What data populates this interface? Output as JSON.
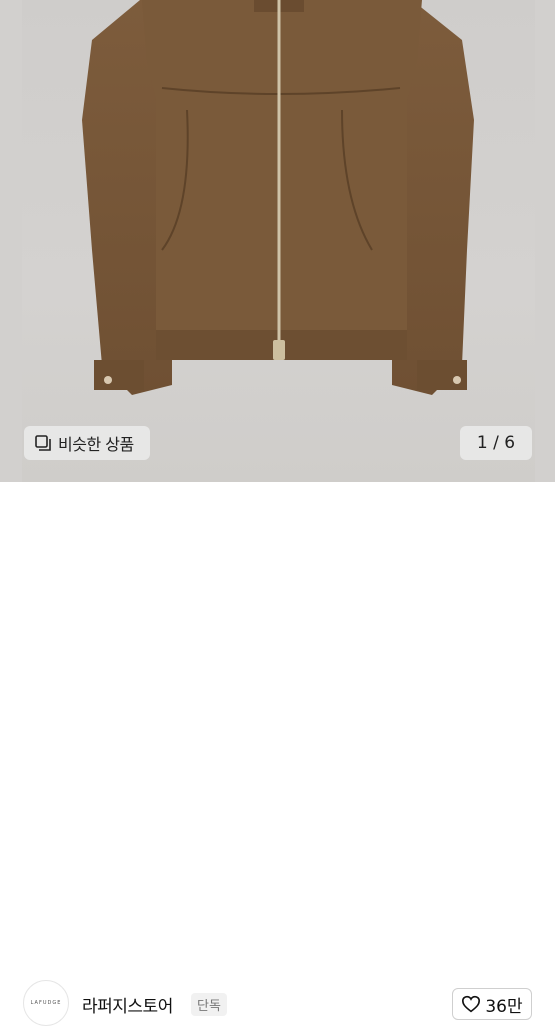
{
  "similar_button": {
    "label": "비슷한 상품",
    "icon": "similar-items-icon"
  },
  "gallery": {
    "counter": "1 / 6",
    "current": 1,
    "total": 6
  },
  "store": {
    "name": "라퍼지스토어",
    "badge": "단독",
    "avatar_text": "LAFUDGE"
  },
  "like_button": {
    "count": "36만",
    "icon": "heart-icon"
  },
  "colors": {
    "jacket": "#7a5a3a",
    "photo_bg": "#d2d0ce"
  }
}
